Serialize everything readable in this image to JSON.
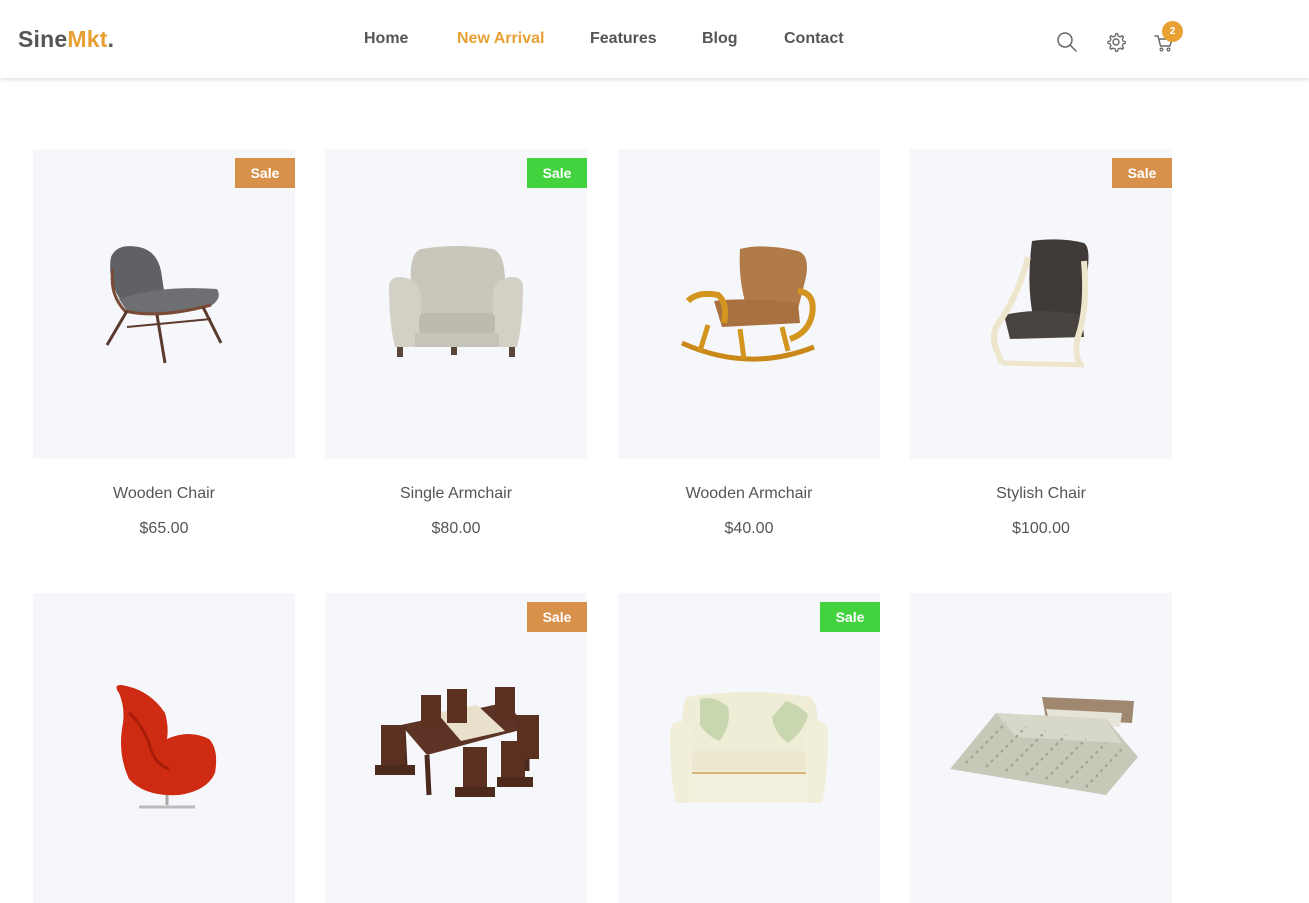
{
  "brand": {
    "part1": "Sine",
    "part2": "Mkt",
    "dot": "."
  },
  "nav": [
    {
      "label": "Home",
      "active": false
    },
    {
      "label": "New Arrival",
      "active": true
    },
    {
      "label": "Features",
      "active": false
    },
    {
      "label": "Blog",
      "active": false
    },
    {
      "label": "Contact",
      "active": false
    }
  ],
  "header_icons": {
    "search": "search-icon",
    "settings": "gear-icon",
    "cart": "cart-icon"
  },
  "cart_count": "2",
  "colors": {
    "accent": "#e8a033",
    "sale_orange": "#d8914a",
    "sale_green": "#42d33e",
    "card_bg": "#f6f7fb"
  },
  "products": [
    {
      "name": "Wooden Chair",
      "price": "$65.00",
      "badge": "Sale",
      "badge_color": "orange"
    },
    {
      "name": "Single Armchair",
      "price": "$80.00",
      "badge": "Sale",
      "badge_color": "green"
    },
    {
      "name": "Wooden Armchair",
      "price": "$40.00",
      "badge": "",
      "badge_color": ""
    },
    {
      "name": "Stylish Chair",
      "price": "$100.00",
      "badge": "Sale",
      "badge_color": "orange"
    },
    {
      "name": "",
      "price": "",
      "badge": "",
      "badge_color": ""
    },
    {
      "name": "",
      "price": "",
      "badge": "Sale",
      "badge_color": "orange"
    },
    {
      "name": "",
      "price": "",
      "badge": "Sale",
      "badge_color": "green"
    },
    {
      "name": "",
      "price": "",
      "badge": "",
      "badge_color": ""
    }
  ]
}
